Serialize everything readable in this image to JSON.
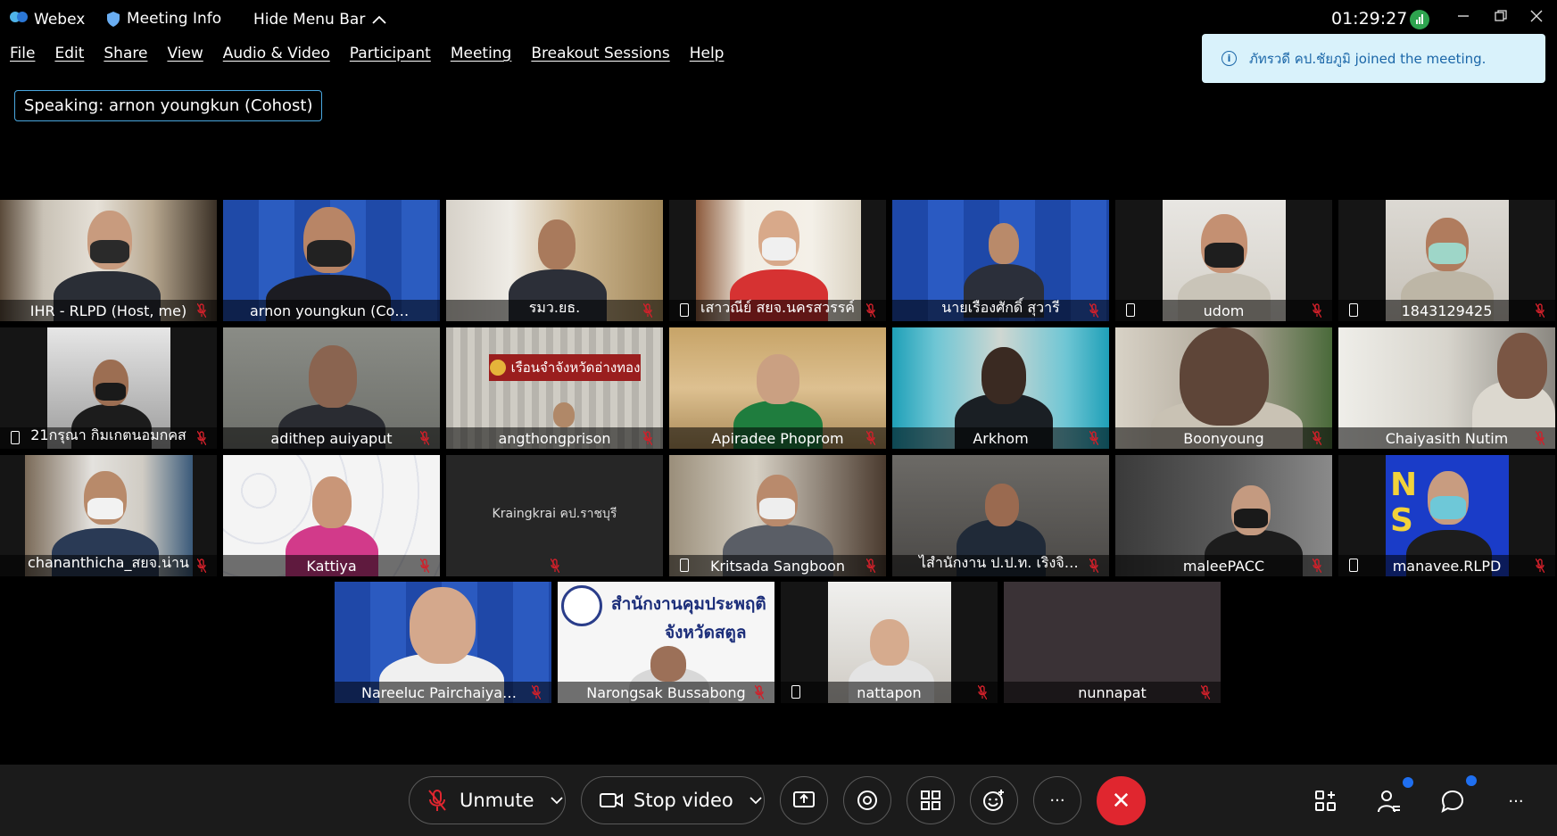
{
  "titlebar": {
    "app_name": "Webex",
    "meeting_info": "Meeting Info",
    "hide_menu": "Hide Menu Bar",
    "clock": "01:29:27"
  },
  "menu": [
    "File",
    "Edit",
    "Share",
    "View",
    "Audio & Video",
    "Participant",
    "Meeting",
    "Breakout Sessions",
    "Help"
  ],
  "toast": {
    "text": "ภัทรวดี คป.ชัยภูมิ joined the meeting."
  },
  "speaking": {
    "label": "Speaking:",
    "name": "arnon youngkun (Cohost)"
  },
  "participants": [
    "IHR - RLPD (Host, me)",
    "arnon youngkun  (Cohost)",
    "รมว.ยธ.",
    "เสาวณีย์ สยจ.นครสวรรค์",
    "นายเรืองศักดิ์ สุวารี",
    "udom",
    "1843129425",
    "21กรุณา กิมเกตนอมกคส",
    "adithep auiyaput",
    "angthongprison",
    "Apiradee Phoprom",
    "Arkhom",
    "Boonyoung",
    "Chaiyasith Nutim",
    "chananthicha_สยจ.น่าน",
    "Kattiya",
    "Kraingkrai คป.ราชบุรี",
    "Kritsada Sangboon",
    "ไสำนักงาน ป.ป.ท. เริงจิตร ฉิม...",
    "maleePACC",
    "manavee.RLPD",
    "Nareeluc Pairchaiyapoom",
    "Narongsak Bussabong",
    "nattapon",
    "nunnapat"
  ],
  "tile_texts": {
    "angthong_sign": "เรือนจำจังหวัดอ่างทอง",
    "satun_sign_line1": "สำนักงานคุมประพฤติ",
    "satun_sign_line2": "จังหวัดสตูล",
    "manavee_bg": "N S"
  },
  "toolbar": {
    "unmute": "Unmute",
    "stop_video": "Stop video",
    "more": "···",
    "end": "✕",
    "overflow": "···"
  },
  "colors": {
    "accent": "#1fa0e8",
    "end_call": "#e0262f",
    "toast_bg": "#d9f2fb",
    "muted_red": "#d0202a"
  }
}
